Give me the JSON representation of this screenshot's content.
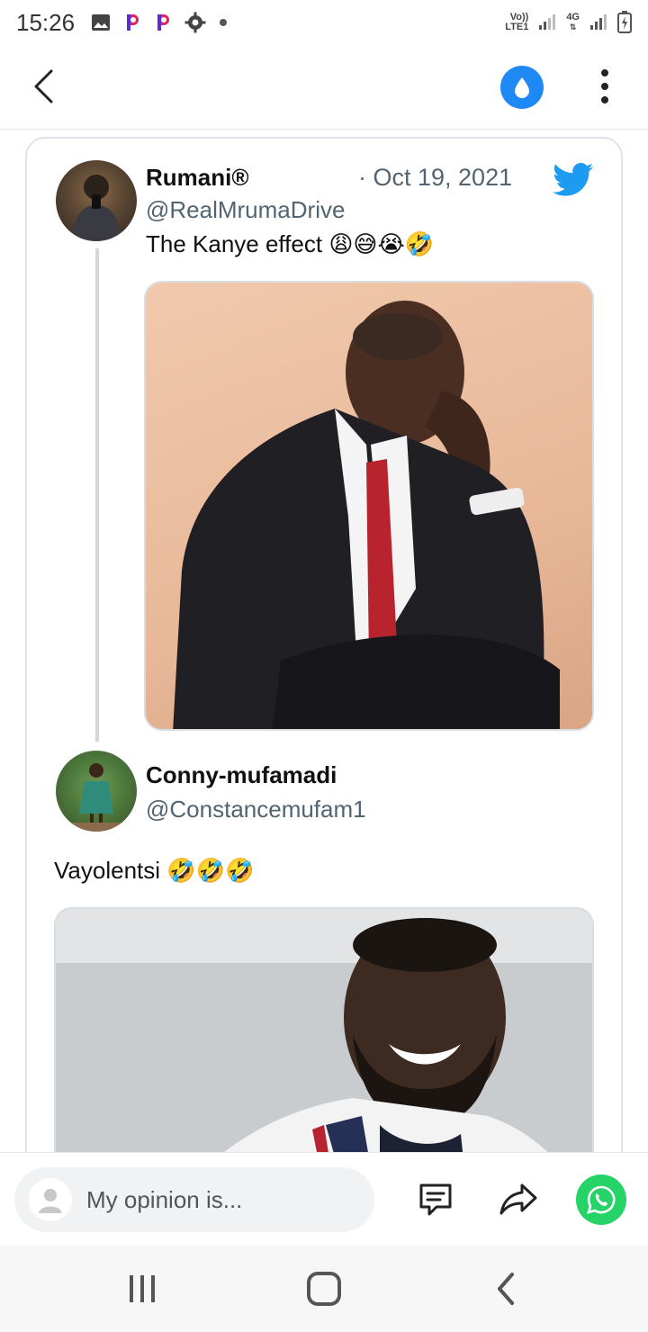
{
  "status_bar": {
    "time": "15:26",
    "icons": [
      "image-icon",
      "p-app-icon",
      "p-app-icon",
      "gear-icon",
      "dot-icon"
    ],
    "network_label_1": "Vo))",
    "network_label_2": "LTE1",
    "network_label_3": "4G",
    "battery_icon": "battery-charging-icon"
  },
  "header": {
    "back_icon": "chevron-left-icon",
    "action_icon": "water-drop-icon",
    "menu_icon": "vertical-dots-icon",
    "accent_color": "#1e88f5"
  },
  "tweet": {
    "author": {
      "name": "Rumani®",
      "handle": "@RealMrumaDrive"
    },
    "date": "· Oct 19, 2021",
    "text": "The Kanye effect 😩😅😭🤣",
    "brand_icon": "twitter-bird-icon",
    "brand_color": "#1d9bf0",
    "media": {
      "description_icon": "photo-man-in-suit"
    }
  },
  "reply": {
    "author": {
      "name": "Conny-mufamadi",
      "handle": "@Constancemufam1"
    },
    "text": "Vayolentsi 🤣🤣🤣",
    "media": {
      "description_icon": "photo-man-laughing"
    }
  },
  "comment_bar": {
    "placeholder": "My opinion is...",
    "comments_icon": "comment-icon",
    "share_icon": "share-arrow-icon",
    "whatsapp_icon": "whatsapp-icon",
    "whatsapp_color": "#25d366"
  },
  "nav": {
    "recent_icon": "recent-apps-icon",
    "home_icon": "home-icon",
    "back_icon": "nav-back-icon"
  }
}
